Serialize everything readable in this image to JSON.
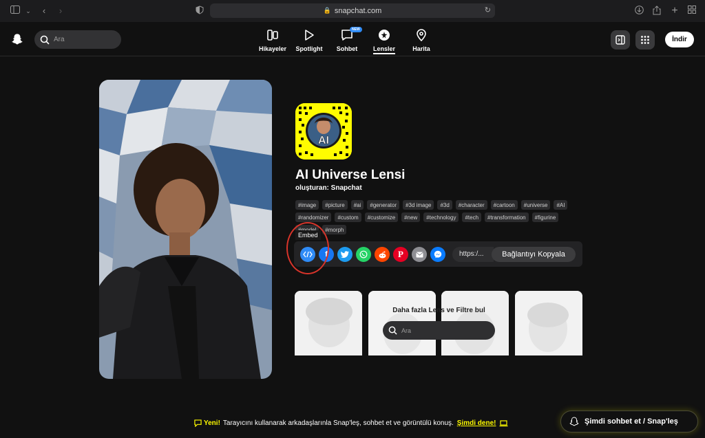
{
  "browser": {
    "url": "snapchat.com"
  },
  "header": {
    "search_placeholder": "Ara",
    "nav": [
      {
        "label": "Hikayeler",
        "icon": "stories-icon"
      },
      {
        "label": "Spotlight",
        "icon": "play-icon"
      },
      {
        "label": "Sohbet",
        "icon": "chat-icon",
        "badge": "NEW"
      },
      {
        "label": "Lensler",
        "icon": "lens-icon",
        "active": true
      },
      {
        "label": "Harita",
        "icon": "map-pin-icon"
      }
    ],
    "download_label": "İndir"
  },
  "lens": {
    "snapcode_text": "AI",
    "title": "AI Universe Lensi",
    "creator": "oluşturan: Snapchat",
    "tags": [
      "#image",
      "#picture",
      "#ai",
      "#generator",
      "#3d image",
      "#3d",
      "#character",
      "#cartoon",
      "#universe",
      "#AI",
      "#randomizer",
      "#custom",
      "#customize",
      "#new",
      "#technology",
      "#tech",
      "#transformation",
      "#figurine",
      "#model",
      "#morph"
    ]
  },
  "share": {
    "tooltip": "Embed",
    "url_text": "https:/...",
    "copy_label": "Bağlantıyı Kopyala",
    "colors": {
      "embed": "#2f8bf6",
      "facebook": "#1877f2",
      "twitter": "#1d9bf0",
      "whatsapp": "#25d366",
      "reddit": "#ff4500",
      "pinterest": "#e60023",
      "email": "#8e8e93",
      "messenger": "#0a7cff"
    }
  },
  "more_lenses": {
    "title": "Daha fazla Lens ve Filtre bul",
    "search_placeholder": "Ara"
  },
  "footer": {
    "new_label": "Yeni!",
    "message": "Tarayıcını kullanarak arkadaşlarınla Snap'leş, sohbet et ve görüntülü konuş.",
    "cta": "Şimdi dene!",
    "chat_button": "Şimdi sohbet et / Snap'leş"
  },
  "colors": {
    "brand_yellow": "#fffc00",
    "background": "#111111"
  }
}
